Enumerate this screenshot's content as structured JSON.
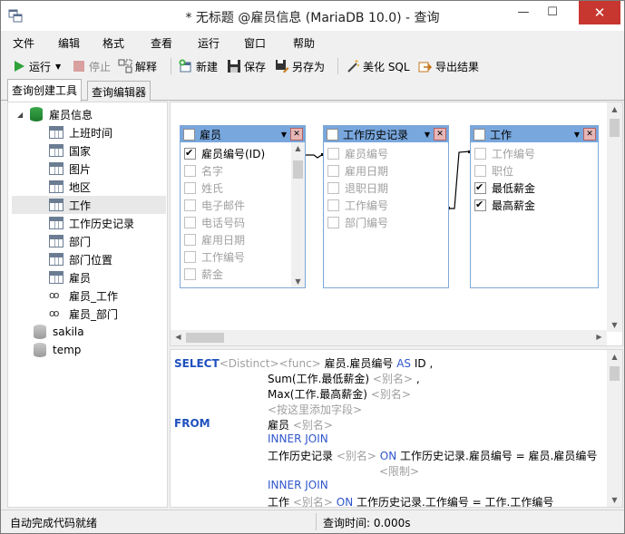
{
  "window": {
    "title": "* 无标题 @雇员信息 (MariaDB 10.0) - 查询"
  },
  "menu": [
    "文件",
    "编辑",
    "格式",
    "查看",
    "运行",
    "窗口",
    "帮助"
  ],
  "toolbar": {
    "run": "运行",
    "stop": "停止",
    "explain": "解释",
    "new": "新建",
    "save": "保存",
    "save_as": "另存为",
    "beautify": "美化 SQL",
    "export": "导出结果"
  },
  "tabs": [
    "查询创建工具",
    "查询编辑器"
  ],
  "tree": {
    "db": "雇员信息",
    "items": [
      {
        "label": "上班时间",
        "kind": "table"
      },
      {
        "label": "国家",
        "kind": "table"
      },
      {
        "label": "图片",
        "kind": "table"
      },
      {
        "label": "地区",
        "kind": "table"
      },
      {
        "label": "工作",
        "kind": "table"
      },
      {
        "label": "工作历史记录",
        "kind": "table"
      },
      {
        "label": "部门",
        "kind": "table"
      },
      {
        "label": "部门位置",
        "kind": "table"
      },
      {
        "label": "雇员",
        "kind": "table"
      },
      {
        "label": "雇员_工作",
        "kind": "view"
      },
      {
        "label": "雇员_部门",
        "kind": "view"
      }
    ],
    "other_dbs": [
      "sakila",
      "temp"
    ]
  },
  "tables": {
    "employee": {
      "title": "雇员",
      "fields": [
        {
          "label": "雇员编号(ID)",
          "checked": true
        },
        {
          "label": "名字",
          "checked": false
        },
        {
          "label": "姓氏",
          "checked": false
        },
        {
          "label": "电子邮件",
          "checked": false
        },
        {
          "label": "电话号码",
          "checked": false
        },
        {
          "label": "雇用日期",
          "checked": false
        },
        {
          "label": "工作编号",
          "checked": false
        },
        {
          "label": "薪金",
          "checked": false
        }
      ]
    },
    "history": {
      "title": "工作历史记录",
      "fields": [
        {
          "label": "雇员编号",
          "checked": false
        },
        {
          "label": "雇用日期",
          "checked": false
        },
        {
          "label": "退职日期",
          "checked": false
        },
        {
          "label": "工作编号",
          "checked": false
        },
        {
          "label": "部门编号",
          "checked": false
        }
      ]
    },
    "job": {
      "title": "工作",
      "fields": [
        {
          "label": "工作编号",
          "checked": false
        },
        {
          "label": "职位",
          "checked": false
        },
        {
          "label": "最低薪金",
          "checked": true
        },
        {
          "label": "最高薪金",
          "checked": true
        }
      ]
    }
  },
  "sql": {
    "select": "SELECT",
    "distinct": "<Distinct>",
    "func": "<func>",
    "col1": "雇员.雇员编号",
    "as": "AS",
    "alias1": "ID ,",
    "col2": "Sum(工作.最低薪金)",
    "alias_hint": "<别名>",
    "comma": ",",
    "col3": "Max(工作.最高薪金)",
    "add_field": "<按这里添加字段>",
    "from": "FROM",
    "t1": "雇员",
    "inner_join": "INNER JOIN",
    "t2": "工作历史记录",
    "on": "ON",
    "cond1": "工作历史记录.雇员编号 = 雇员.雇员编号",
    "limit": "<限制>",
    "t3": "工作",
    "cond2": "工作历史记录.工作编号 = 工作.工作编号"
  },
  "status": {
    "left": "自动完成代码就绪",
    "right": "查询时间: 0.000s"
  }
}
